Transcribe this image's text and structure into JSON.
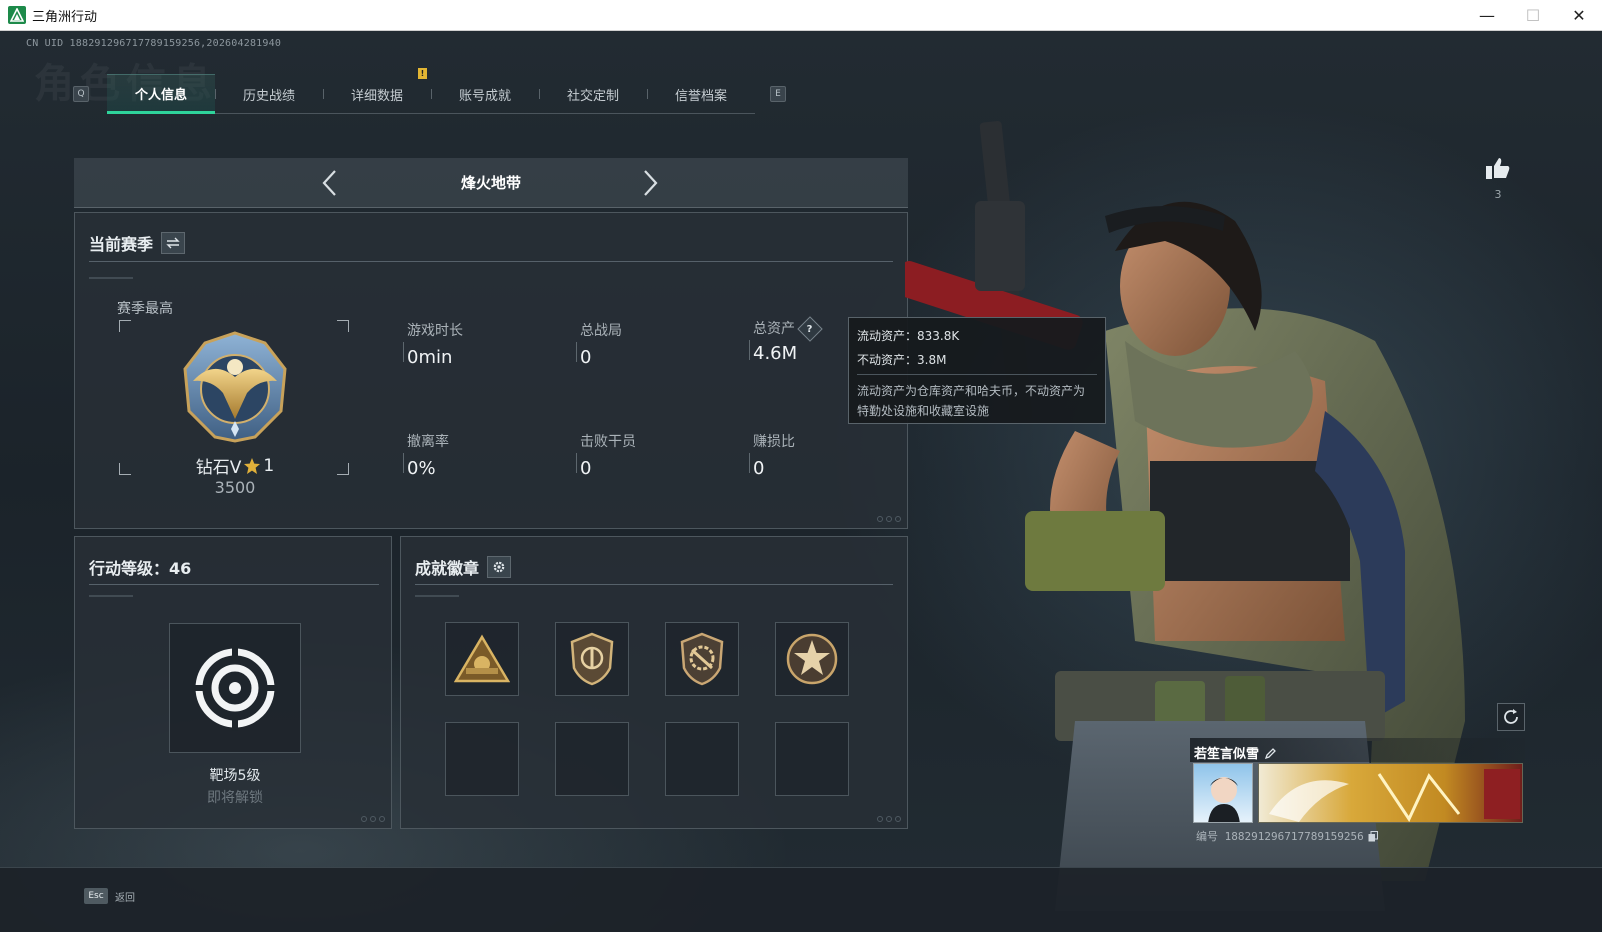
{
  "window": {
    "title": "三角洲行动",
    "minimize": "—",
    "maximize": "☐",
    "close": "✕"
  },
  "uid_line": "CN UID 188291296717789159256,202604281940",
  "watermark": "角色信息",
  "tabs": {
    "left_key": "Q",
    "right_key": "E",
    "alert": "!",
    "items": [
      {
        "label": "个人信息",
        "active": true
      },
      {
        "label": "历史战绩",
        "active": false
      },
      {
        "label": "详细数据",
        "active": false
      },
      {
        "label": "账号成就",
        "active": false
      },
      {
        "label": "社交定制",
        "active": false
      },
      {
        "label": "信誉档案",
        "active": false
      }
    ]
  },
  "mode": {
    "title": "烽火地带"
  },
  "season": {
    "header": "当前赛季",
    "best_label": "赛季最高",
    "rank_name": "钻石V",
    "rank_stars": "1",
    "rank_score": "3500",
    "stats": [
      {
        "label": "游戏时长",
        "value": "0min"
      },
      {
        "label": "总战局",
        "value": "0"
      },
      {
        "label": "总资产",
        "value": "4.6M",
        "help": "?"
      },
      {
        "label": "撤离率",
        "value": "0%"
      },
      {
        "label": "击败干员",
        "value": "0"
      },
      {
        "label": "赚损比",
        "value": "0"
      }
    ]
  },
  "tooltip": {
    "liquid": "流动资产：833.8K",
    "fixed": "不动资产：3.8M",
    "desc_line1": "流动资产为仓库资产和哈夫币，不动资产为",
    "desc_line2": "特勤处设施和收藏室设施"
  },
  "level": {
    "header": "行动等级：46",
    "name": "靶场5级",
    "sub": "即将解锁"
  },
  "achievements": {
    "header": "成就徽章",
    "badges": [
      "triangle-badge",
      "shield-badge",
      "gear-shield-badge",
      "star-badge"
    ]
  },
  "profile": {
    "likes": "3",
    "name": "若笙言似雪",
    "id_line": "编号 188291296717789159256"
  },
  "bottom": {
    "esc_key": "Esc",
    "esc_label": "返回"
  },
  "colors": {
    "accent": "#2fd49b",
    "alert": "#e2b533",
    "star": "#e0b03a"
  }
}
